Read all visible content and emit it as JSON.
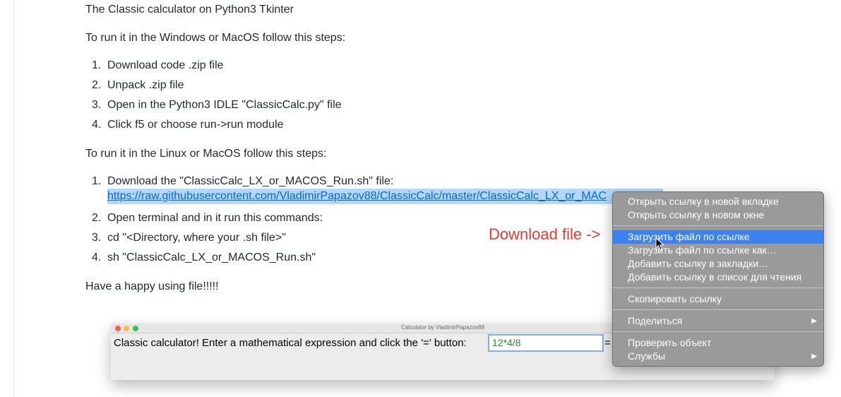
{
  "readme": {
    "intro": "The Classic calculator on Python3 Tkinter",
    "win_heading": "To run it in the Windows or MacOS follow this steps:",
    "win_steps": [
      "Download code .zip file",
      "Unpack .zip file",
      "Open in the Python3 IDLE \"ClassicCalc.py\" file",
      "Click f5 or choose run->run module"
    ],
    "linux_heading": "To run it in the Linux or MacOS follow this steps:",
    "linux_steps": [
      "Download the \"ClassicCalc_LX_or_MACOS_Run.sh\" file:",
      "Open terminal and in it run this commands:",
      "cd \"<Directory, where your .sh file>\"",
      "sh \"ClassicCalc_LX_or_MACOS_Run.sh\""
    ],
    "link_text": "https://raw.githubusercontent.com/VladimirPapazov88/ClassicCalc/master/ClassicCalc_LX_or_MAC",
    "outro": "Have a happy using file!!!!!",
    "numbers": [
      "1.",
      "2.",
      "3.",
      "4."
    ]
  },
  "annotation": "Download file ->",
  "calculator": {
    "window_title": "Calculator by VladimirPapazov88",
    "prompt": "Classic calculator! Enter a mathematical expression and click the '=' button:",
    "expression": "12*4/8",
    "equals_label": "="
  },
  "context_menu": {
    "items": [
      "Открыть ссылку в новой вкладке",
      "Открыть ссылку в новом окне",
      "Загрузить файл по ссылке",
      "Загрузить файл по ссылке как…",
      "Добавить ссылку в закладки…",
      "Добавить ссылку в список для чтения",
      "Скопировать ссылку",
      "Поделиться",
      "Проверить объект",
      "Службы"
    ],
    "highlighted_index": 2,
    "submenu_arrow": "▶"
  },
  "colors": {
    "link": "#0366d6",
    "link_selection": "#b3d7ff",
    "annotation": "#e8382f",
    "menu_highlight": "#3b82f0",
    "menu_background": "#9a9a9a"
  }
}
